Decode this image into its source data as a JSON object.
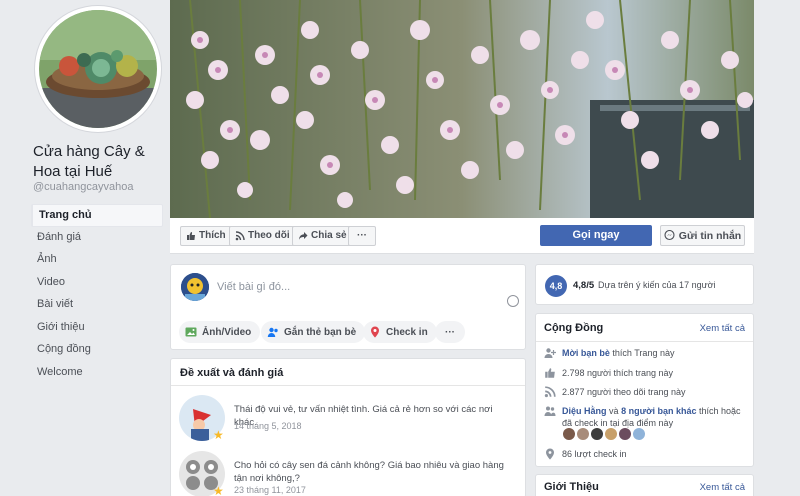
{
  "page": {
    "name": "Cửa hàng Cây & Hoa tại Huế",
    "handle": "@cuahangcayvahoa"
  },
  "nav": {
    "items": [
      {
        "label": "Trang chủ",
        "active": true
      },
      {
        "label": "Đánh giá"
      },
      {
        "label": "Ảnh"
      },
      {
        "label": "Video"
      },
      {
        "label": "Bài viết"
      },
      {
        "label": "Giới thiệu"
      },
      {
        "label": "Cộng đồng"
      },
      {
        "label": "Welcome"
      }
    ]
  },
  "actions": {
    "like": "Thích",
    "follow": "Theo dõi",
    "share": "Chia sẻ",
    "more": "···",
    "call": "Gọi ngay",
    "message": "Gửi tin nhắn"
  },
  "composer": {
    "placeholder": "Viết bài gì đó...",
    "photo_video": "Ảnh/Video",
    "tag_friends": "Gắn thẻ bạn bè",
    "check_in": "Check in",
    "more": "···"
  },
  "reviews": {
    "title": "Đề xuất và đánh giá",
    "items": [
      {
        "text": "Thái độ vui vẻ, tư vấn nhiệt tình. Giá cả rẻ hơn so với các nơi khác.",
        "date": "14 tháng 5, 2018"
      },
      {
        "text": "Cho hỏi có cây sen đá cảnh không? Giá bao nhiêu và giao hàng tận nơi không,?",
        "date": "23 tháng 11, 2017"
      }
    ]
  },
  "rating": {
    "badge": "4,8",
    "score": "4,8/5",
    "description": "Dựa trên ý kiến của 17 người"
  },
  "community": {
    "title": "Cộng Đồng",
    "see_all": "Xem tất cả",
    "invite_link": "Mời bạn bè",
    "invite_text": "thích Trang này",
    "likes": "2.798 người thích trang này",
    "follows": "2.877 người theo dõi trang này",
    "friend_name": "Diệu Hằng",
    "friend_and": "và",
    "friend_others": "8 người bạn khác",
    "friend_text": "thích hoặc đã check in tại địa điểm này",
    "checkins": "86 lượt check in"
  },
  "about": {
    "title": "Giới Thiệu",
    "see_all": "Xem tất cả"
  },
  "colors": {
    "brand": "#4267b2",
    "link": "#385898",
    "background": "#e9ebee"
  }
}
